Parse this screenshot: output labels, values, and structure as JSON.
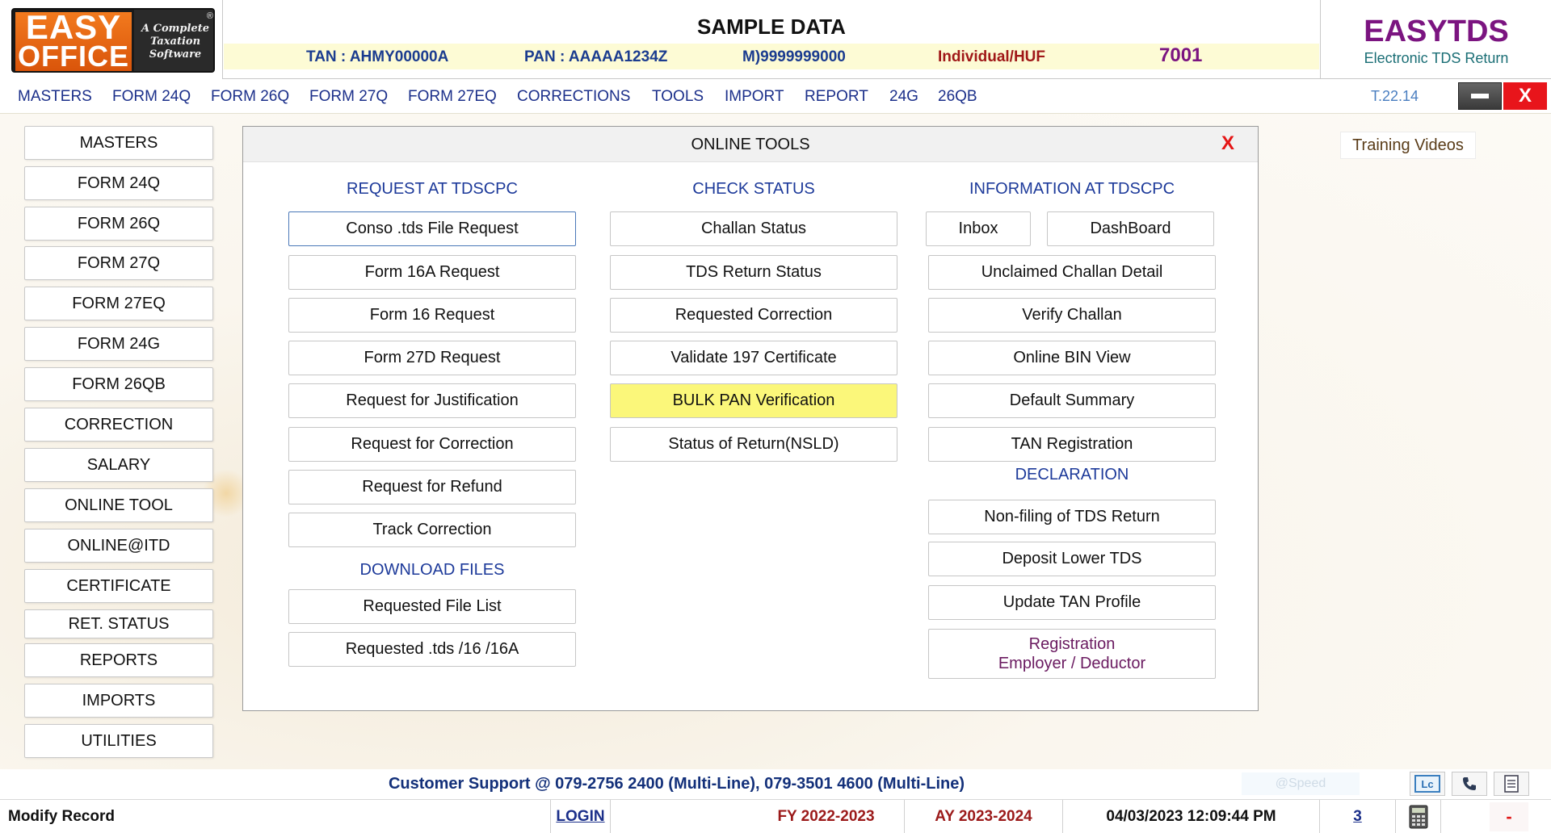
{
  "header": {
    "logo": {
      "line1": "EASY",
      "line2": "OFFICE",
      "tagline": [
        "A Complete",
        "Taxation",
        "Software"
      ],
      "reg_mark": "®"
    },
    "title": "SAMPLE DATA",
    "tan": "TAN : AHMY00000A",
    "pan": "PAN : AAAAA1234Z",
    "mobile": "M)9999999000",
    "category": "Individual/HUF",
    "code": "7001",
    "product_name": "EASYTDS",
    "product_sub": "Electronic TDS Return"
  },
  "menubar": {
    "items": [
      "MASTERS",
      "FORM 24Q",
      "FORM 26Q",
      "FORM 27Q",
      "FORM 27EQ",
      "CORRECTIONS",
      "TOOLS",
      "IMPORT",
      "REPORT",
      "24G",
      "26QB"
    ],
    "version": "T.22.14",
    "close_label": "X"
  },
  "sidebar": {
    "items": [
      "MASTERS",
      "FORM 24Q",
      "FORM 26Q",
      "FORM 27Q",
      "FORM 27EQ",
      "FORM 24G",
      "FORM 26QB",
      "CORRECTION",
      "SALARY",
      "ONLINE TOOL",
      "ONLINE@ITD",
      "CERTIFICATE",
      "RET. STATUS",
      "REPORTS",
      "IMPORTS",
      "UTILITIES"
    ]
  },
  "dialog": {
    "title": "ONLINE TOOLS",
    "close_label": "X",
    "col1": {
      "heading": "REQUEST AT TDSCPC",
      "buttons": [
        "Conso .tds File Request",
        "Form 16A Request",
        "Form 16 Request",
        "Form 27D Request",
        "Request for Justification",
        "Request for Correction",
        "Request for Refund",
        "Track Correction"
      ],
      "download_heading": "DOWNLOAD FILES",
      "download_buttons": [
        "Requested File List",
        "Requested .tds /16 /16A"
      ]
    },
    "col2": {
      "heading": "CHECK STATUS",
      "buttons": [
        "Challan Status",
        "TDS Return Status",
        "Requested Correction",
        "Validate 197 Certificate",
        "BULK PAN Verification",
        "Status of Return(NSLD)"
      ]
    },
    "col3": {
      "heading": "INFORMATION AT TDSCPC",
      "inbox": "Inbox",
      "dashboard": "DashBoard",
      "buttons": [
        "Unclaimed Challan Detail",
        "Verify Challan",
        "Online BIN View",
        "Default Summary",
        "TAN Registration"
      ],
      "declaration_heading": "DECLARATION",
      "declaration_buttons": [
        "Non-filing of TDS Return",
        "Deposit Lower TDS",
        "Update TAN Profile"
      ],
      "registration_line1": "Registration",
      "registration_line2": "Employer / Deductor"
    }
  },
  "training_videos": "Training Videos",
  "support": {
    "text": "Customer Support @ 079-2756 2400 (Multi-Line), 079-3501 4600 (Multi-Line)",
    "speed": "@Speed"
  },
  "statusbar": {
    "mode": "Modify Record",
    "login": "LOGIN",
    "fy": "FY 2022-2023",
    "ay": "AY 2023-2024",
    "datetime": "04/03/2023 12:09:44 PM",
    "count": "3",
    "indicator": "-"
  },
  "colors": {
    "brand_purple": "#7b1480",
    "menu_blue": "#1b2f8a",
    "fy_red": "#9b1a1a",
    "highlight_yellow": "#fbf77a"
  }
}
